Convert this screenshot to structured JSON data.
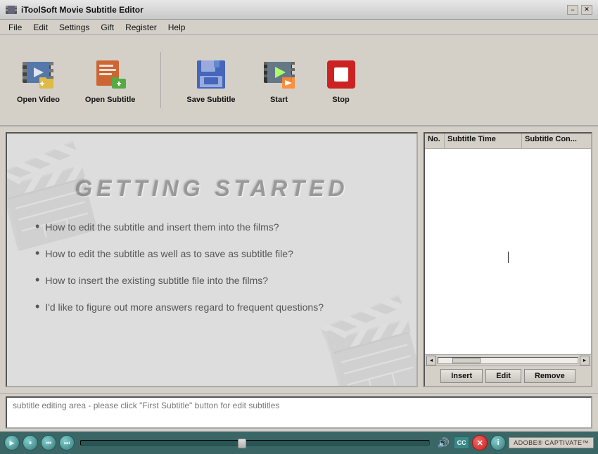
{
  "window": {
    "title": "iToolSoft Movie Subtitle Editor",
    "controls": {
      "minimize": "−",
      "close": "✕"
    }
  },
  "menu": {
    "items": [
      "File",
      "Edit",
      "Settings",
      "Gift",
      "Register",
      "Help"
    ]
  },
  "toolbar": {
    "buttons": [
      {
        "id": "open-video",
        "label": "Open Video",
        "icon": "film-open"
      },
      {
        "id": "open-subtitle",
        "label": "Open Subtitle",
        "icon": "subtitle-open"
      },
      {
        "id": "save-subtitle",
        "label": "Save Subtitle",
        "icon": "floppy"
      },
      {
        "id": "start",
        "label": "Start",
        "icon": "film-start"
      },
      {
        "id": "stop",
        "label": "Stop",
        "icon": "stop-red"
      }
    ]
  },
  "preview": {
    "getting_started_title": "GETTING   STARTED",
    "bullets": [
      "How to edit the subtitle and insert them into the films?",
      "How to edit the subtitle as well as to save as subtitle file?",
      "How to insert the existing subtitle file into the films?",
      "I'd like to figure out more answers regard to frequent questions?"
    ]
  },
  "subtitle_table": {
    "columns": [
      "No.",
      "Subtitle Time",
      "Subtitle Con..."
    ],
    "rows": []
  },
  "subtitle_actions": {
    "insert": "Insert",
    "edit": "Edit",
    "remove": "Remove"
  },
  "subtitle_edit": {
    "placeholder": "subtitle editing area - please click \"First Subtitle\" button for edit subtitles"
  },
  "player": {
    "captivate_label": "ADOBE® CAPTIVATE™"
  }
}
